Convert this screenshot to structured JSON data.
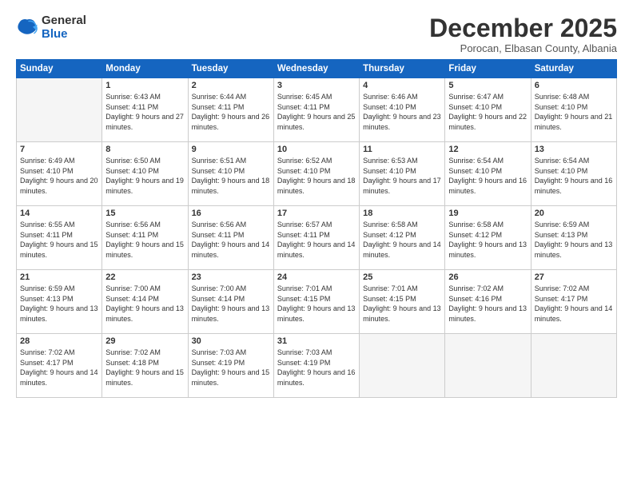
{
  "logo": {
    "general": "General",
    "blue": "Blue"
  },
  "title": "December 2025",
  "subtitle": "Porocan, Elbasan County, Albania",
  "days_header": [
    "Sunday",
    "Monday",
    "Tuesday",
    "Wednesday",
    "Thursday",
    "Friday",
    "Saturday"
  ],
  "weeks": [
    [
      {
        "day": "",
        "empty": true
      },
      {
        "day": "1",
        "sunrise": "6:43 AM",
        "sunset": "4:11 PM",
        "daylight": "9 hours and 27 minutes."
      },
      {
        "day": "2",
        "sunrise": "6:44 AM",
        "sunset": "4:11 PM",
        "daylight": "9 hours and 26 minutes."
      },
      {
        "day": "3",
        "sunrise": "6:45 AM",
        "sunset": "4:11 PM",
        "daylight": "9 hours and 25 minutes."
      },
      {
        "day": "4",
        "sunrise": "6:46 AM",
        "sunset": "4:10 PM",
        "daylight": "9 hours and 23 minutes."
      },
      {
        "day": "5",
        "sunrise": "6:47 AM",
        "sunset": "4:10 PM",
        "daylight": "9 hours and 22 minutes."
      },
      {
        "day": "6",
        "sunrise": "6:48 AM",
        "sunset": "4:10 PM",
        "daylight": "9 hours and 21 minutes."
      }
    ],
    [
      {
        "day": "7",
        "sunrise": "6:49 AM",
        "sunset": "4:10 PM",
        "daylight": "9 hours and 20 minutes."
      },
      {
        "day": "8",
        "sunrise": "6:50 AM",
        "sunset": "4:10 PM",
        "daylight": "9 hours and 19 minutes."
      },
      {
        "day": "9",
        "sunrise": "6:51 AM",
        "sunset": "4:10 PM",
        "daylight": "9 hours and 18 minutes."
      },
      {
        "day": "10",
        "sunrise": "6:52 AM",
        "sunset": "4:10 PM",
        "daylight": "9 hours and 18 minutes."
      },
      {
        "day": "11",
        "sunrise": "6:53 AM",
        "sunset": "4:10 PM",
        "daylight": "9 hours and 17 minutes."
      },
      {
        "day": "12",
        "sunrise": "6:54 AM",
        "sunset": "4:10 PM",
        "daylight": "9 hours and 16 minutes."
      },
      {
        "day": "13",
        "sunrise": "6:54 AM",
        "sunset": "4:10 PM",
        "daylight": "9 hours and 16 minutes."
      }
    ],
    [
      {
        "day": "14",
        "sunrise": "6:55 AM",
        "sunset": "4:11 PM",
        "daylight": "9 hours and 15 minutes."
      },
      {
        "day": "15",
        "sunrise": "6:56 AM",
        "sunset": "4:11 PM",
        "daylight": "9 hours and 15 minutes."
      },
      {
        "day": "16",
        "sunrise": "6:56 AM",
        "sunset": "4:11 PM",
        "daylight": "9 hours and 14 minutes."
      },
      {
        "day": "17",
        "sunrise": "6:57 AM",
        "sunset": "4:11 PM",
        "daylight": "9 hours and 14 minutes."
      },
      {
        "day": "18",
        "sunrise": "6:58 AM",
        "sunset": "4:12 PM",
        "daylight": "9 hours and 14 minutes."
      },
      {
        "day": "19",
        "sunrise": "6:58 AM",
        "sunset": "4:12 PM",
        "daylight": "9 hours and 13 minutes."
      },
      {
        "day": "20",
        "sunrise": "6:59 AM",
        "sunset": "4:13 PM",
        "daylight": "9 hours and 13 minutes."
      }
    ],
    [
      {
        "day": "21",
        "sunrise": "6:59 AM",
        "sunset": "4:13 PM",
        "daylight": "9 hours and 13 minutes."
      },
      {
        "day": "22",
        "sunrise": "7:00 AM",
        "sunset": "4:14 PM",
        "daylight": "9 hours and 13 minutes."
      },
      {
        "day": "23",
        "sunrise": "7:00 AM",
        "sunset": "4:14 PM",
        "daylight": "9 hours and 13 minutes."
      },
      {
        "day": "24",
        "sunrise": "7:01 AM",
        "sunset": "4:15 PM",
        "daylight": "9 hours and 13 minutes."
      },
      {
        "day": "25",
        "sunrise": "7:01 AM",
        "sunset": "4:15 PM",
        "daylight": "9 hours and 13 minutes."
      },
      {
        "day": "26",
        "sunrise": "7:02 AM",
        "sunset": "4:16 PM",
        "daylight": "9 hours and 13 minutes."
      },
      {
        "day": "27",
        "sunrise": "7:02 AM",
        "sunset": "4:17 PM",
        "daylight": "9 hours and 14 minutes."
      }
    ],
    [
      {
        "day": "28",
        "sunrise": "7:02 AM",
        "sunset": "4:17 PM",
        "daylight": "9 hours and 14 minutes."
      },
      {
        "day": "29",
        "sunrise": "7:02 AM",
        "sunset": "4:18 PM",
        "daylight": "9 hours and 15 minutes."
      },
      {
        "day": "30",
        "sunrise": "7:03 AM",
        "sunset": "4:19 PM",
        "daylight": "9 hours and 15 minutes."
      },
      {
        "day": "31",
        "sunrise": "7:03 AM",
        "sunset": "4:19 PM",
        "daylight": "9 hours and 16 minutes."
      },
      {
        "day": "",
        "empty": true
      },
      {
        "day": "",
        "empty": true
      },
      {
        "day": "",
        "empty": true
      }
    ]
  ]
}
